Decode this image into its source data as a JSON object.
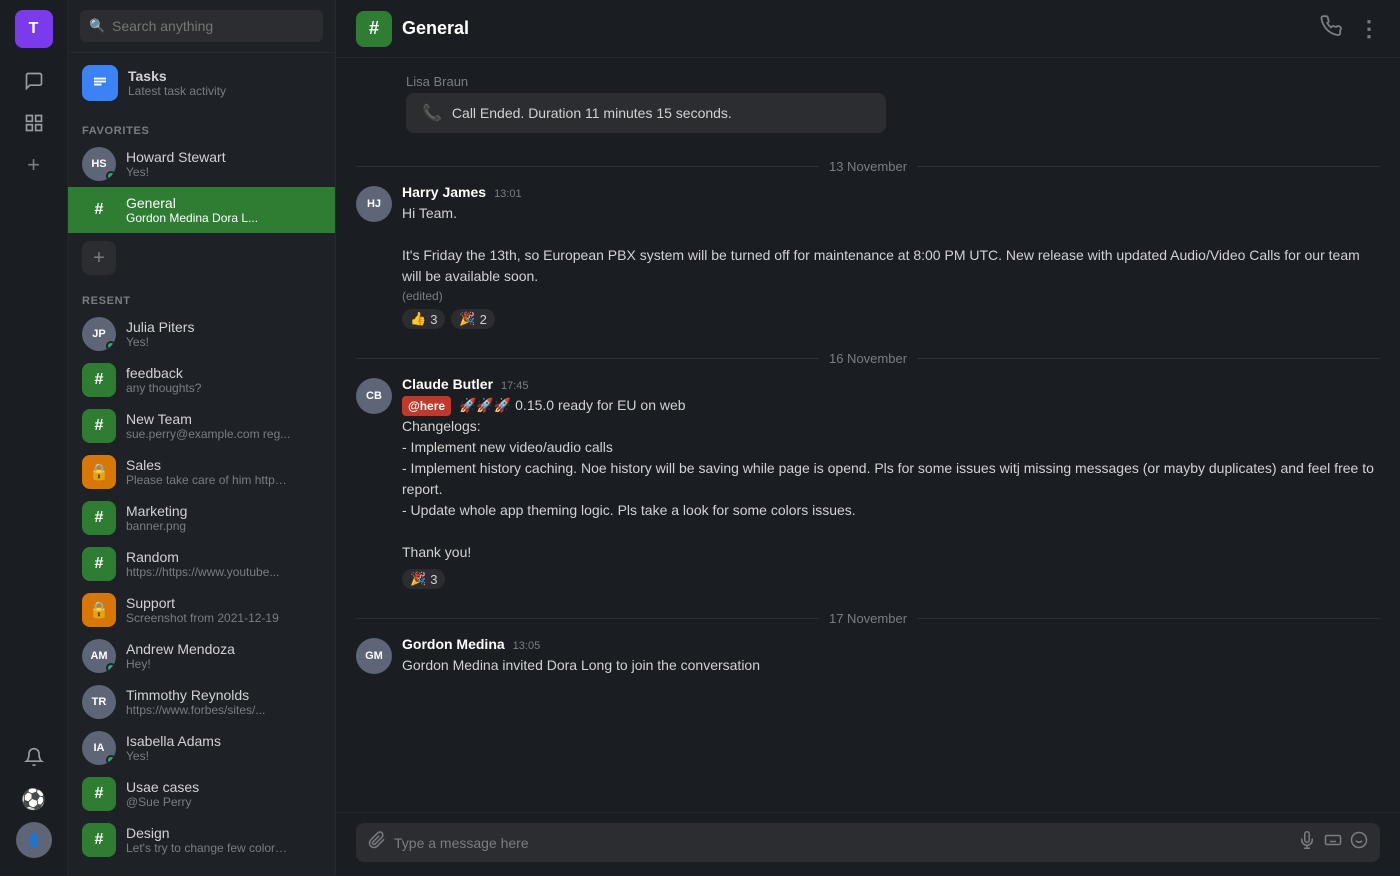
{
  "app": {
    "user_initial": "T",
    "channel_title": "General"
  },
  "icon_bar": {
    "chat_icon": "💬",
    "grid_icon": "⊞",
    "add_icon": "+",
    "bell_icon": "🔔",
    "soccer_icon": "⚽"
  },
  "sidebar": {
    "search_placeholder": "Search anything",
    "tasks": {
      "title": "Tasks",
      "subtitle": "Latest task activity"
    },
    "favorites_header": "FAVORITES",
    "favorites": [
      {
        "name": "Howard Stewart",
        "preview": "Yes!",
        "online": true,
        "type": "avatar",
        "initials": "HS"
      },
      {
        "name": "General",
        "preview": "Gordon Medina Dora L...",
        "online": false,
        "type": "channel",
        "color": "green",
        "active": true
      }
    ],
    "resent_header": "RESENT",
    "resent": [
      {
        "name": "Julia Piters",
        "preview": "Yes!",
        "online": true,
        "type": "avatar",
        "initials": "JP"
      },
      {
        "name": "feedback",
        "preview": "any thoughts?",
        "type": "channel",
        "color": "green"
      },
      {
        "name": "New Team",
        "preview": "sue.perry@example.com reg...",
        "type": "channel",
        "color": "green"
      },
      {
        "name": "Sales",
        "preview": "Please take care of him https:/...",
        "type": "channel",
        "color": "orange"
      },
      {
        "name": "Marketing",
        "preview": "banner.png",
        "type": "channel",
        "color": "green"
      },
      {
        "name": "Random",
        "preview": "https://https://www.youtube...",
        "type": "channel",
        "color": "green"
      },
      {
        "name": "Support",
        "preview": "Screenshot from 2021-12-19",
        "type": "channel",
        "color": "orange"
      },
      {
        "name": "Andrew Mendoza",
        "preview": "Hey!",
        "online": true,
        "type": "avatar",
        "initials": "AM"
      },
      {
        "name": "Timmothy Reynolds",
        "preview": "https://www.forbes/sites/...",
        "type": "avatar",
        "initials": "TR"
      },
      {
        "name": "Isabella Adams",
        "preview": "Yes!",
        "online": true,
        "type": "avatar",
        "initials": "IA"
      },
      {
        "name": "Usae cases",
        "preview": "@Sue Perry",
        "type": "channel",
        "color": "green"
      },
      {
        "name": "Design",
        "preview": "Let's try to change few colors ...",
        "type": "channel",
        "color": "green"
      }
    ]
  },
  "chat": {
    "header": {
      "channel_icon": "#",
      "title": "General",
      "phone_icon": "📞",
      "more_icon": "⋮"
    },
    "call_ended": {
      "sender": "Lisa Braun",
      "text": "Call Ended. Duration 11 minutes 15 seconds."
    },
    "date_sections": [
      {
        "date": "13 November",
        "messages": [
          {
            "sender": "Harry James",
            "time": "13:01",
            "avatar_initials": "HJ",
            "lines": [
              "Hi Team.",
              "",
              "It's Friday the 13th, so European PBX system will be turned off for maintenance at 8:00 PM UTC. New release with updated Audio/Video Calls for our team will be available soon."
            ],
            "edited": true,
            "reactions": [
              {
                "emoji": "👍",
                "count": "3"
              },
              {
                "emoji": "🎉",
                "count": "2"
              }
            ]
          }
        ]
      },
      {
        "date": "16  November",
        "messages": [
          {
            "sender": "Claude Butler",
            "time": "17:45",
            "avatar_initials": "CB",
            "mention": "@here",
            "lines": [
              "🚀🚀🚀 0.15.0 ready for EU on web",
              "Changelogs:",
              "- Implement new video/audio calls",
              "- Implement history caching. Noe history will be saving while page is opend. Pls for some issues witj missing messages (or mayby duplicates) and  feel free to report.",
              "- Update whole app theming logic. Pls take a look for some colors issues.",
              "",
              "Thank you!"
            ],
            "reactions": [
              {
                "emoji": "🎉",
                "count": "3"
              }
            ]
          }
        ]
      },
      {
        "date": "17  November",
        "messages": [
          {
            "sender": "Gordon Medina",
            "time": "13:05",
            "avatar_initials": "GM",
            "lines": [
              "Gordon Medina invited Dora Long to join the conversation"
            ]
          }
        ]
      }
    ],
    "input_placeholder": "Type a message here"
  }
}
